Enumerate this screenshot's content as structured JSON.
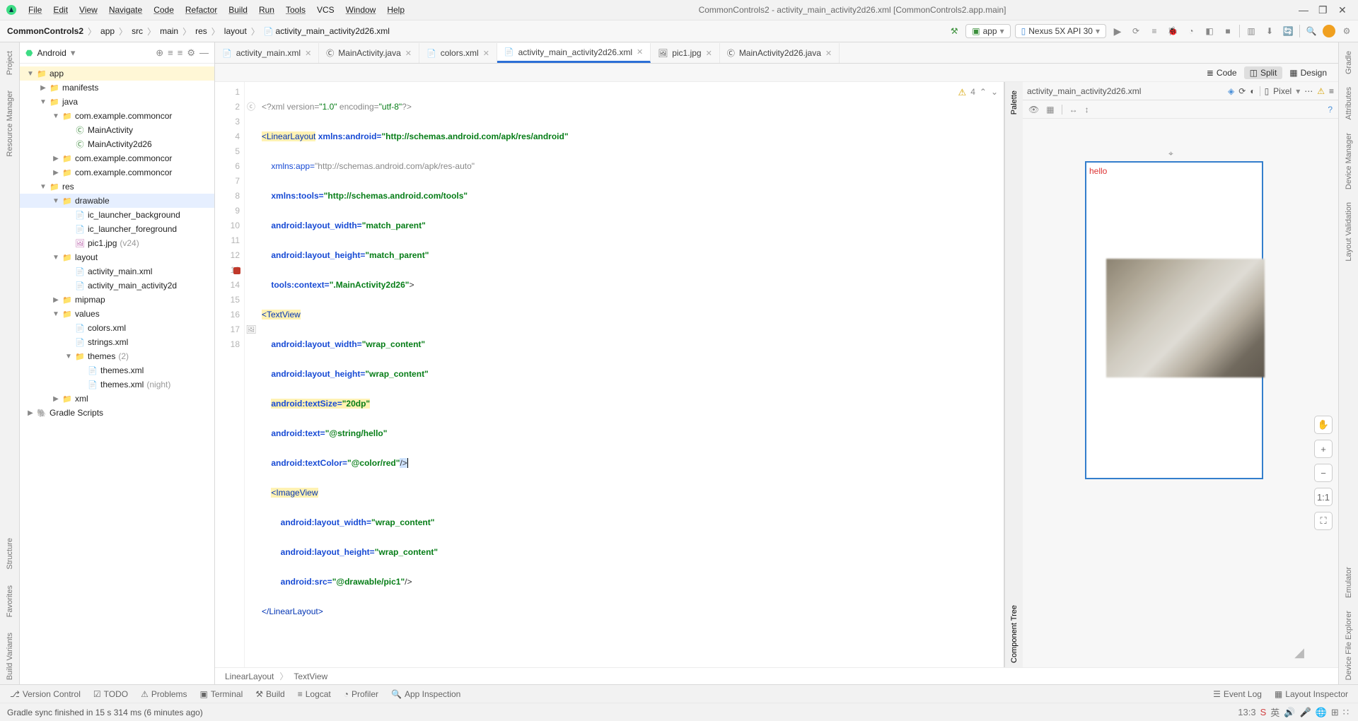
{
  "window": {
    "title": "CommonControls2 - activity_main_activity2d26.xml [CommonControls2.app.main]",
    "minimize": "—",
    "maximize": "❐",
    "close": "✕"
  },
  "menu": {
    "file": "File",
    "edit": "Edit",
    "view": "View",
    "navigate": "Navigate",
    "code": "Code",
    "refactor": "Refactor",
    "build": "Build",
    "run": "Run",
    "tools": "Tools",
    "vcs": "VCS",
    "window": "Window",
    "help": "Help"
  },
  "breadcrumb": [
    "CommonControls2",
    "app",
    "src",
    "main",
    "res",
    "layout",
    "activity_main_activity2d26.xml"
  ],
  "toolbar": {
    "runConfig": "app",
    "device": "Nexus 5X API 30"
  },
  "leftRail": {
    "project": "Project",
    "resourceManager": "Resource Manager",
    "structure": "Structure",
    "favorites": "Favorites",
    "buildVariants": "Build Variants"
  },
  "rightRail": {
    "gradle": "Gradle",
    "attributes": "Attributes",
    "deviceManager": "Device Manager",
    "layoutValidation": "Layout Validation",
    "emulator": "Emulator",
    "fileExplorer": "Device File Explorer"
  },
  "project": {
    "viewLabel": "Android",
    "tree": [
      {
        "lvl": 0,
        "caret": "▼",
        "ico": "folder",
        "label": "app",
        "cls": "app"
      },
      {
        "lvl": 1,
        "caret": "▶",
        "ico": "folder",
        "label": "manifests"
      },
      {
        "lvl": 1,
        "caret": "▼",
        "ico": "folder",
        "label": "java"
      },
      {
        "lvl": 2,
        "caret": "▼",
        "ico": "folder",
        "label": "com.example.commoncor"
      },
      {
        "lvl": 3,
        "caret": "",
        "ico": "jav",
        "label": "MainActivity"
      },
      {
        "lvl": 3,
        "caret": "",
        "ico": "jav",
        "label": "MainActivity2d26"
      },
      {
        "lvl": 2,
        "caret": "▶",
        "ico": "folder",
        "label": "com.example.commoncor"
      },
      {
        "lvl": 2,
        "caret": "▶",
        "ico": "folder",
        "label": "com.example.commoncor"
      },
      {
        "lvl": 1,
        "caret": "▼",
        "ico": "folder",
        "label": "res"
      },
      {
        "lvl": 2,
        "caret": "▼",
        "ico": "folder",
        "label": "drawable",
        "cls": "sel"
      },
      {
        "lvl": 3,
        "caret": "",
        "ico": "xml",
        "label": "ic_launcher_background"
      },
      {
        "lvl": 3,
        "caret": "",
        "ico": "xml",
        "label": "ic_launcher_foreground"
      },
      {
        "lvl": 3,
        "caret": "",
        "ico": "img",
        "label": "pic1.jpg",
        "dim": " (v24)"
      },
      {
        "lvl": 2,
        "caret": "▼",
        "ico": "folder",
        "label": "layout"
      },
      {
        "lvl": 3,
        "caret": "",
        "ico": "xml",
        "label": "activity_main.xml"
      },
      {
        "lvl": 3,
        "caret": "",
        "ico": "xml",
        "label": "activity_main_activity2d"
      },
      {
        "lvl": 2,
        "caret": "▶",
        "ico": "folder",
        "label": "mipmap"
      },
      {
        "lvl": 2,
        "caret": "▼",
        "ico": "folder",
        "label": "values"
      },
      {
        "lvl": 3,
        "caret": "",
        "ico": "xml",
        "label": "colors.xml"
      },
      {
        "lvl": 3,
        "caret": "",
        "ico": "xml",
        "label": "strings.xml"
      },
      {
        "lvl": 3,
        "caret": "▼",
        "ico": "folder",
        "label": "themes",
        "dim": " (2)"
      },
      {
        "lvl": 4,
        "caret": "",
        "ico": "xml",
        "label": "themes.xml"
      },
      {
        "lvl": 4,
        "caret": "",
        "ico": "xml",
        "label": "themes.xml",
        "dim": " (night)"
      },
      {
        "lvl": 2,
        "caret": "▶",
        "ico": "folder",
        "label": "xml"
      },
      {
        "lvl": 0,
        "caret": "▶",
        "ico": "gradle",
        "label": "Gradle Scripts"
      }
    ]
  },
  "tabs": [
    {
      "ico": "xml",
      "label": "activity_main.xml",
      "active": false
    },
    {
      "ico": "jav",
      "label": "MainActivity.java",
      "active": false
    },
    {
      "ico": "xml",
      "label": "colors.xml",
      "active": false
    },
    {
      "ico": "xml",
      "label": "activity_main_activity2d26.xml",
      "active": true
    },
    {
      "ico": "img",
      "label": "pic1.jpg",
      "active": false
    },
    {
      "ico": "jav",
      "label": "MainActivity2d26.java",
      "active": false
    }
  ],
  "viewMode": {
    "code": "Code",
    "split": "Split",
    "design": "Design"
  },
  "code": {
    "lines": 18,
    "breakpointLine": 13,
    "warnings": "4",
    "l1a": "<?xml version=",
    "l1b": "\"1.0\"",
    "l1c": " encoding=",
    "l1d": "\"utf-8\"",
    "l1e": "?>",
    "l2a": "<LinearLayout",
    "l2b": " xmlns:android=",
    "l2c": "\"http://schemas.android.com/apk/res/android\"",
    "l3a": "xmlns:app=",
    "l3b": "\"http://schemas.android.com/apk/res-auto\"",
    "l4a": "xmlns:tools=",
    "l4b": "\"http://schemas.android.com/tools\"",
    "l5a": "android:layout_width=",
    "l5b": "\"match_parent\"",
    "l6a": "android:layout_height=",
    "l6b": "\"match_parent\"",
    "l7a": "tools:context=",
    "l7b": "\".MainActivity2d26\"",
    "l7c": ">",
    "l8": "<TextView",
    "l9a": "android:layout_width=",
    "l9b": "\"wrap_content\"",
    "l10a": "android:layout_height=",
    "l10b": "\"wrap_content\"",
    "l11a": "android:textSize=",
    "l11b": "\"20dp\"",
    "l12a": "android:text=",
    "l12b": "\"@string/hello\"",
    "l13a": "android:textColor=",
    "l13b": "\"@color/red\"",
    "l13c": "/>",
    "l14": "<ImageView",
    "l15a": "android:layout_width=",
    "l15b": "\"wrap_content\"",
    "l16a": "android:layout_height=",
    "l16b": "\"wrap_content\"",
    "l17a": "android:src=",
    "l17b": "\"@drawable/pic1\"",
    "l17c": "/>",
    "l18": "</LinearLayout>"
  },
  "breadcrumb2": {
    "a": "LinearLayout",
    "b": "TextView"
  },
  "designTop": {
    "file": "activity_main_activity2d26.xml",
    "unit": "Pixel"
  },
  "preview": {
    "hello": "hello",
    "zoom": [
      "✋",
      "+",
      "−",
      "1:1",
      "⛶"
    ]
  },
  "palette": {
    "palette": "Palette",
    "componentTree": "Component Tree"
  },
  "bottomTabs": {
    "vc": "Version Control",
    "todo": "TODO",
    "problems": "Problems",
    "terminal": "Terminal",
    "build": "Build",
    "logcat": "Logcat",
    "profiler": "Profiler",
    "appInspection": "App Inspection",
    "eventLog": "Event Log",
    "layoutInspector": "Layout Inspector"
  },
  "status": {
    "msg": "Gradle sync finished in 15 s 314 ms (6 minutes ago)",
    "time": "13:3"
  }
}
